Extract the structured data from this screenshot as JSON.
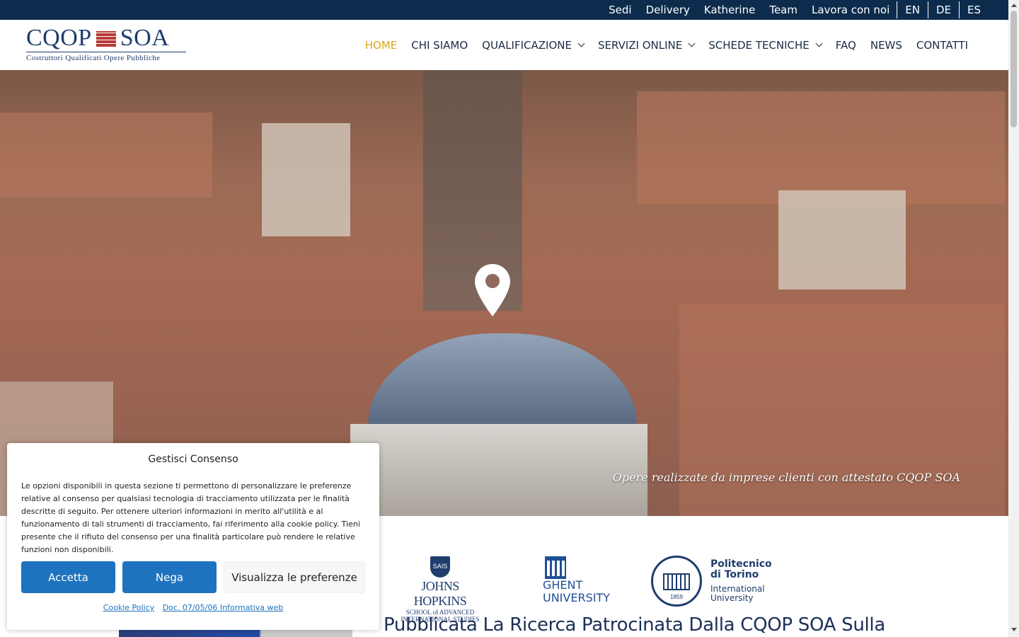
{
  "topbar": {
    "links": [
      "Sedi",
      "Delivery",
      "Katherine",
      "Team",
      "Lavora con noi"
    ],
    "languages": [
      "EN",
      "DE",
      "ES"
    ]
  },
  "logo": {
    "left": "CQOP",
    "right": "SOA",
    "subtitle": "Costruttori Qualificati Opere Pubbliche"
  },
  "nav": {
    "items": [
      {
        "label": "HOME",
        "active": true,
        "dropdown": false
      },
      {
        "label": "CHI SIAMO",
        "active": false,
        "dropdown": false
      },
      {
        "label": "QUALIFICAZIONE",
        "active": false,
        "dropdown": true
      },
      {
        "label": "SERVIZI ONLINE",
        "active": false,
        "dropdown": true
      },
      {
        "label": "SCHEDE TECNICHE",
        "active": false,
        "dropdown": true
      },
      {
        "label": "FAQ",
        "active": false,
        "dropdown": false
      },
      {
        "label": "NEWS",
        "active": false,
        "dropdown": false
      },
      {
        "label": "CONTATTI",
        "active": false,
        "dropdown": false
      }
    ]
  },
  "hero": {
    "caption": "Opere realizzate da imprese clienti con attestato CQOP SOA"
  },
  "partners": {
    "jh_seal": "SAIS",
    "jh_name": "JOHNS HOPKINS",
    "jh_sub1": "SCHOOL of ADVANCED",
    "jh_sub2": "INTERNATIONAL STUDIES",
    "ghent1": "GHENT",
    "ghent2": "UNIVERSITY",
    "polito_year": "1859",
    "polito1": "Politecnico",
    "polito2": "di Torino",
    "polito3": "International",
    "polito4": "University"
  },
  "headline": "Pubblicata La Ricerca Patrocinata Dalla CQOP SOA Sulla",
  "consent": {
    "title": "Gestisci Consenso",
    "text": "Le opzioni disponibili in questa sezione ti permettono di personalizzare le preferenze relative al consenso per qualsiasi tecnologia di tracciamento utilizzata per le finalità descritte di seguito. Per ottenere ulteriori informazioni in merito all'utilità e al funzionamento di tali strumenti di tracciamento, fai riferimento alla cookie policy. Tieni presente che il rifiuto del consenso per una finalità particolare può rendere le relative funzioni non disponibili.",
    "accept": "Accetta",
    "deny": "Nega",
    "preferences": "Visualizza le preferenze",
    "link_cookie": "Cookie Policy",
    "link_doc": "Doc. 07/05/06 Informativa web"
  },
  "colors": {
    "topbar": "#0d2c4d",
    "nav_active": "#d9a91b",
    "button_primary": "#1e73be",
    "brand_navy": "#1f3d6d"
  }
}
